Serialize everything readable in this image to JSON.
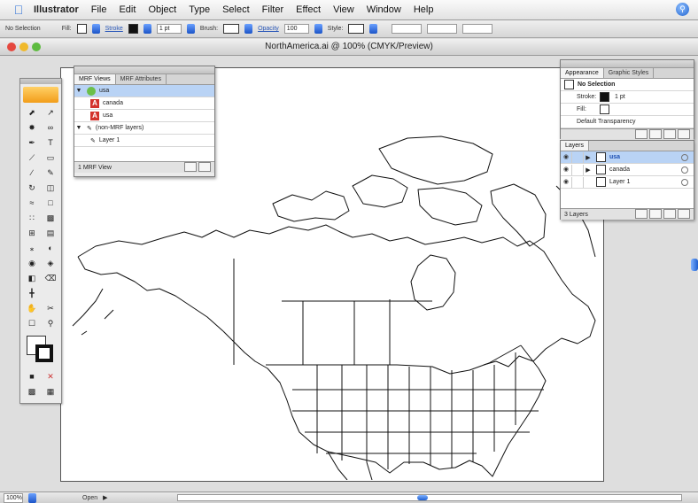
{
  "menubar": {
    "app": "Illustrator",
    "items": [
      "File",
      "Edit",
      "Object",
      "Type",
      "Select",
      "Filter",
      "Effect",
      "View",
      "Window",
      "Help"
    ]
  },
  "controlbar": {
    "selection": "No Selection",
    "fill_label": "Fill:",
    "stroke_label": "Stroke",
    "stroke_weight": "1 pt",
    "brush_label": "Brush:",
    "opacity_label": "Opacity",
    "opacity_value": "100",
    "style_label": "Style:"
  },
  "document": {
    "title": "NorthAmerica.ai @ 100% (CMYK/Preview)"
  },
  "mrf_panel": {
    "tabs": [
      "MRF Views",
      "MRF Attributes"
    ],
    "rows": [
      {
        "label": "usa",
        "kind": "view",
        "selected": true
      },
      {
        "label": "canada",
        "kind": "item"
      },
      {
        "label": "usa",
        "kind": "item"
      },
      {
        "label": "(non-MRF layers)",
        "kind": "group"
      },
      {
        "label": "Layer 1",
        "kind": "item"
      }
    ],
    "footer": "1 MRF View"
  },
  "appearance_panel": {
    "tabs": [
      "Appearance",
      "Graphic Styles"
    ],
    "header": "No Selection",
    "stroke_label": "Stroke:",
    "stroke_value": "1 pt",
    "fill_label": "Fill:",
    "transparency": "Default Transparency"
  },
  "layers_panel": {
    "tabs": [
      "Layers"
    ],
    "rows": [
      {
        "label": "usa",
        "selected": true
      },
      {
        "label": "canada",
        "selected": false
      },
      {
        "label": "Layer 1",
        "selected": false
      }
    ],
    "footer": "3 Layers"
  },
  "status": {
    "zoom": "100%",
    "label": "Open"
  }
}
